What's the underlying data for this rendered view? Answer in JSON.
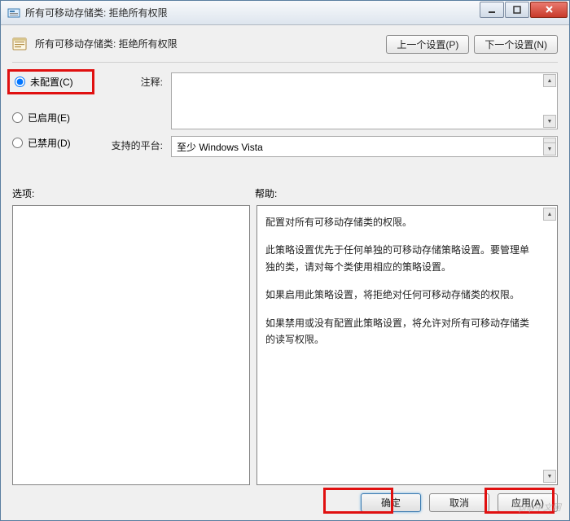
{
  "window": {
    "title": "所有可移动存储类: 拒绝所有权限"
  },
  "header": {
    "policy_title": "所有可移动存储类: 拒绝所有权限",
    "prev_btn": "上一个设置(P)",
    "next_btn": "下一个设置(N)"
  },
  "radios": {
    "unconfigured": "未配置(C)",
    "enabled": "已启用(E)",
    "disabled": "已禁用(D)"
  },
  "fields": {
    "comment_label": "注释:",
    "platform_label": "支持的平台:",
    "platform_value": "至少 Windows Vista"
  },
  "labels": {
    "options": "选项:",
    "help": "帮助:"
  },
  "help": {
    "p1": "配置对所有可移动存储类的权限。",
    "p2": "此策略设置优先于任何单独的可移动存储策略设置。要管理单独的类，请对每个类使用相应的策略设置。",
    "p3": "如果启用此策略设置，将拒绝对任何可移动存储类的权限。",
    "p4": "如果禁用或没有配置此策略设置，将允许对所有可移动存储类的读写权限。"
  },
  "footer": {
    "ok": "确定",
    "cancel": "取消",
    "apply": "应用(A)"
  },
  "watermark": "php中文网"
}
